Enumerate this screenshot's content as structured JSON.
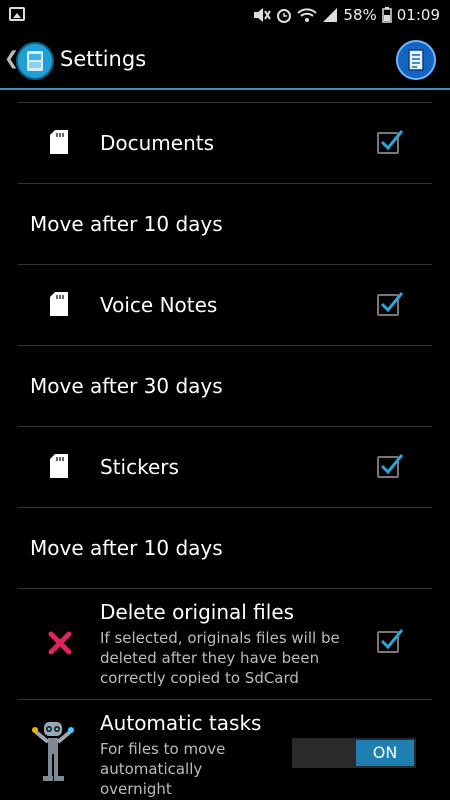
{
  "status_bar": {
    "battery": "58%",
    "time": "01:09",
    "icons": [
      "gallery-icon",
      "mute-icon",
      "alarm-icon",
      "wifi-icon",
      "signal-icon",
      "battery-icon"
    ]
  },
  "app_bar": {
    "title": "Settings",
    "back_icon": "chevron-left-icon",
    "app_icon": "sd-card-app-icon",
    "action_icon": "document-list-icon"
  },
  "rows": [
    {
      "label": "Documents",
      "checked": true,
      "icon": "sd-card-icon"
    },
    {
      "label": "Move after 10 days"
    },
    {
      "label": "Voice Notes",
      "checked": true,
      "icon": "sd-card-icon"
    },
    {
      "label": "Move after 30 days"
    },
    {
      "label": "Stickers",
      "checked": true,
      "icon": "sd-card-icon"
    },
    {
      "label": "Move after 10 days"
    }
  ],
  "delete_original": {
    "title": "Delete original files",
    "subtitle": "If selected, originals files will be deleted after they have been correctly copied to SdCard",
    "checked": true,
    "icon": "red-x-icon"
  },
  "automatic_tasks": {
    "title": "Automatic tasks",
    "subtitle": "For files to move automatically overnight",
    "toggle_label": "ON",
    "icon": "robot-icon"
  },
  "colors": {
    "accent": "#3f8fc4",
    "check": "#2ea3d8",
    "toggle_on": "#1e7fb0",
    "delete_x": "#e0245e"
  }
}
